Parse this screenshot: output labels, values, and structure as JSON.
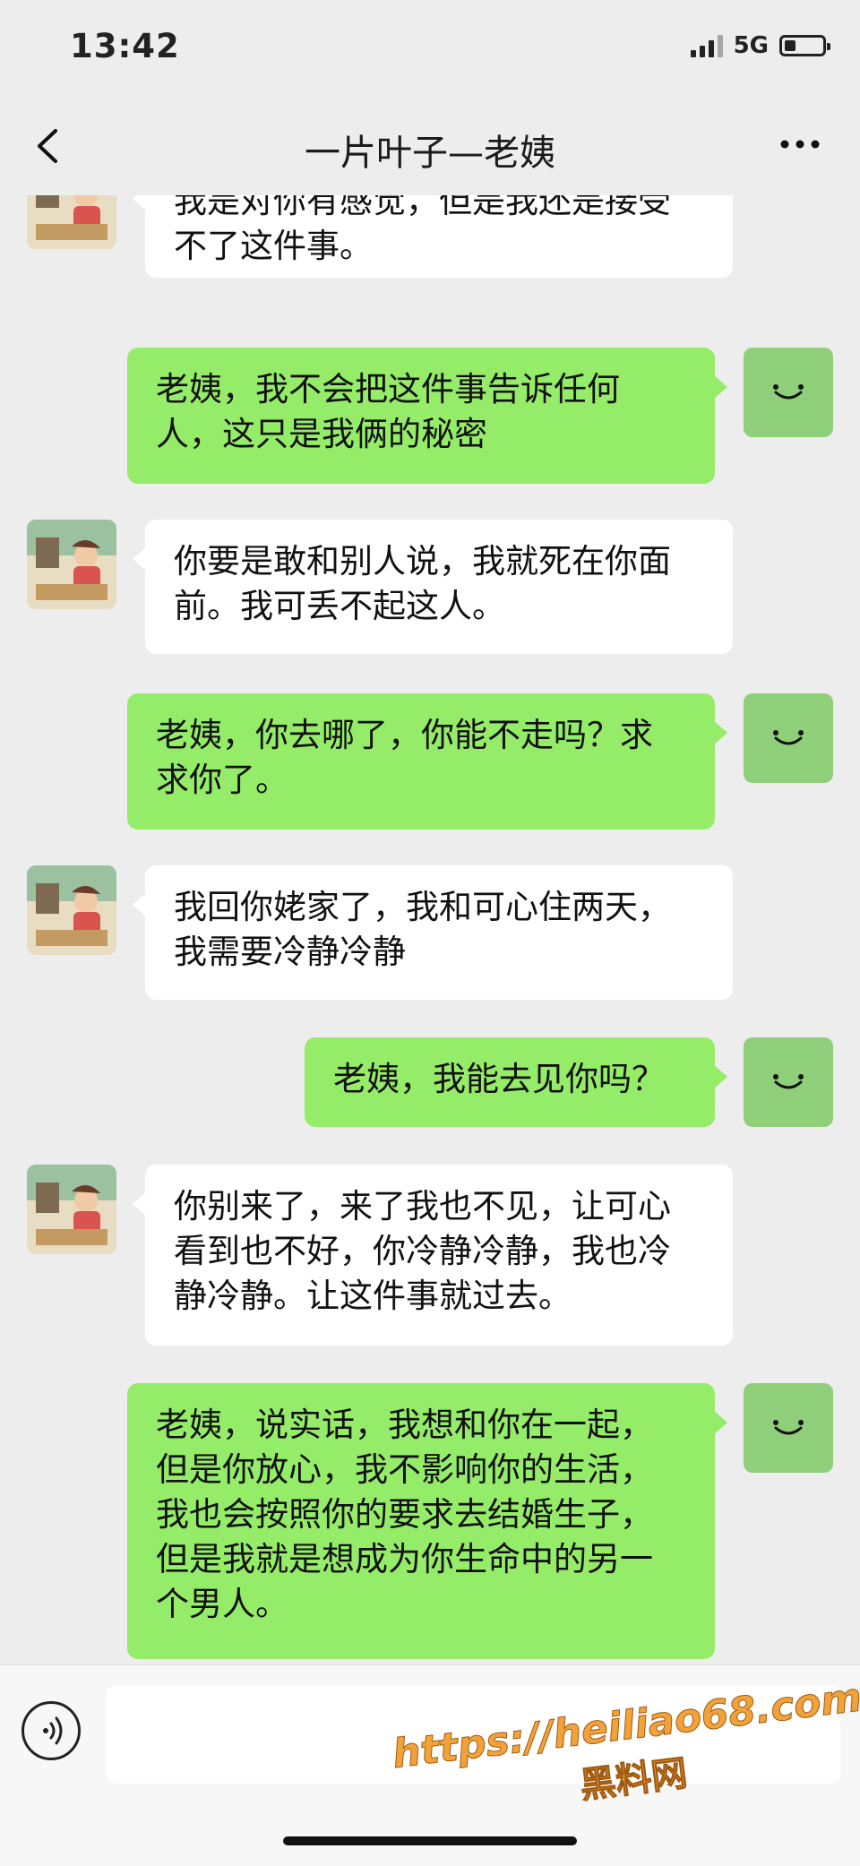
{
  "status_bar": {
    "time": "13:42",
    "network": "5G"
  },
  "nav": {
    "title": "一片叶子—老姨"
  },
  "messages": [
    {
      "side": "left",
      "text": "我是对你有感觉，但是我还是接受\n不了这件事。"
    },
    {
      "side": "right",
      "text": "老姨，我不会把这件事告诉任何\n人，这只是我俩的秘密"
    },
    {
      "side": "left",
      "text": "你要是敢和别人说，我就死在你面\n前。我可丢不起这人。"
    },
    {
      "side": "right",
      "text": "老姨，你去哪了，你能不走吗？求\n求你了。"
    },
    {
      "side": "left",
      "text": "我回你姥家了，我和可心住两天，\n我需要冷静冷静"
    },
    {
      "side": "right",
      "text": "老姨，我能去见你吗？"
    },
    {
      "side": "left",
      "text": "你别来了，来了我也不见，让可心\n看到也不好，你冷静冷静，我也冷\n静冷静。让这件事就过去。"
    },
    {
      "side": "right",
      "text": "老姨，说实话，我想和你在一起，\n但是你放心，我不影响你的生活，\n我也会按照你的要求去结婚生子，\n但是我就是想成为你生命中的另一\n个男人。"
    }
  ],
  "input": {
    "value": ""
  },
  "watermark": {
    "url": "https://heiliao68.com",
    "label": "黑料网"
  },
  "colors": {
    "background": "#ededed",
    "sent_bubble": "#95ec69",
    "received_bubble": "#ffffff",
    "watermark": "#f2a23a"
  }
}
